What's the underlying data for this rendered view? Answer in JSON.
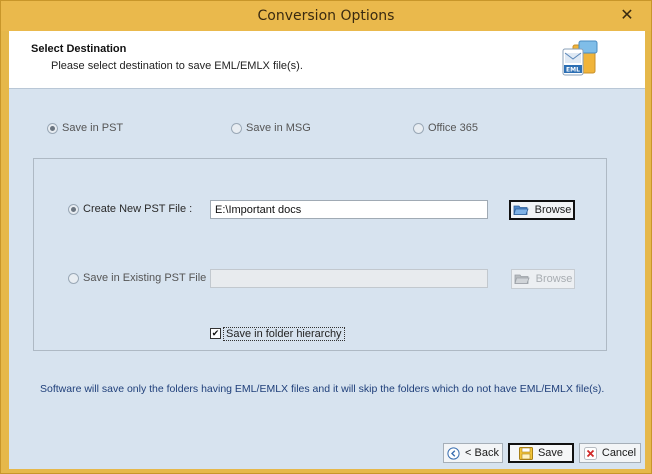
{
  "window": {
    "title": "Conversion Options",
    "close_glyph": "✕"
  },
  "header": {
    "title": "Select Destination",
    "subtitle": "Please select destination to save EML/EMLX file(s).",
    "icon": "eml-file-icon",
    "icon_label": "EML"
  },
  "save_options": [
    {
      "label": "Save in PST",
      "checked": true
    },
    {
      "label": "Save in MSG",
      "checked": false
    },
    {
      "label": "Office 365",
      "checked": false
    }
  ],
  "pst_group": {
    "create_new": {
      "label": "Create New PST File :",
      "checked": true,
      "value": "E:\\Important docs",
      "browse_label": "Browse"
    },
    "existing": {
      "label": "Save in Existing PST File :",
      "checked": false,
      "value": "",
      "browse_label": "Browse"
    },
    "folder_hierarchy": {
      "label": "Save in folder hierarchy",
      "checked": true
    }
  },
  "note": "Software will save only the folders having EML/EMLX files and it will skip the folders which do not have EML/EMLX file(s).",
  "footer": {
    "back_label": "< Back",
    "save_label": "Save",
    "cancel_label": "Cancel"
  },
  "colors": {
    "title_bar": "#eab94c",
    "client_bg": "#d7e3ef",
    "note_text": "#1f3f7a",
    "cancel_icon": "#d02a2a"
  }
}
